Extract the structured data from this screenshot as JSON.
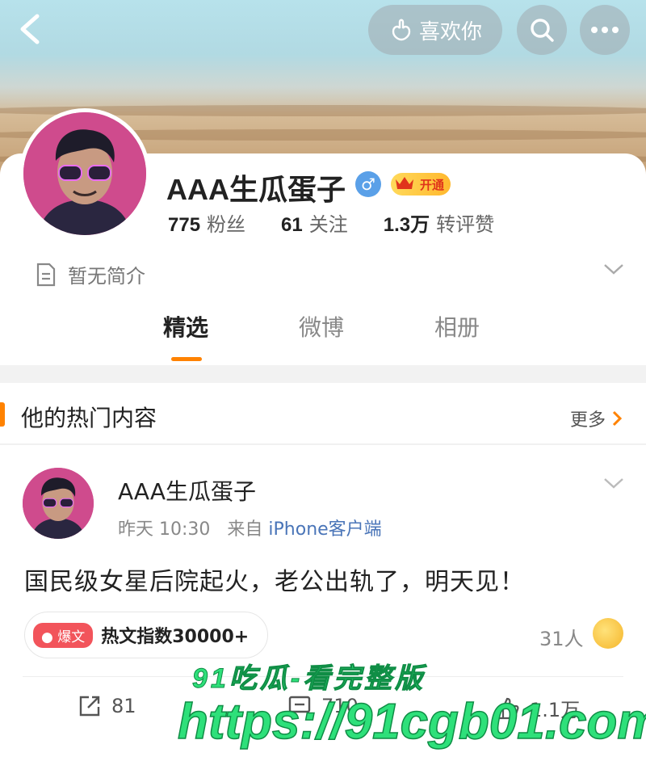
{
  "header": {
    "like_label": "喜欢你"
  },
  "profile": {
    "name": "AAA生瓜蛋子",
    "vip_label": "开通",
    "stats": [
      {
        "num": "775",
        "label": "粉丝"
      },
      {
        "num": "61",
        "label": "关注"
      },
      {
        "num": "1.3万",
        "label": "转评赞"
      }
    ],
    "intro": "暂无简介"
  },
  "tabs": [
    {
      "label": "精选",
      "active": true
    },
    {
      "label": "微博",
      "active": false
    },
    {
      "label": "相册",
      "active": false
    }
  ],
  "hot_section": {
    "title": "他的热门内容",
    "more_label": "更多"
  },
  "post": {
    "author": "AAA生瓜蛋子",
    "time": "昨天 10:30",
    "from_prefix": "来自",
    "source": "iPhone客户端",
    "text": "国民级女星后院起火，老公出轨了，明天见！",
    "heat_badge": "爆文",
    "heat_text": "热文指数30000+",
    "people": "31人",
    "reposts": "81",
    "comments": "710",
    "likes": "1.1万"
  },
  "watermark": {
    "line1": "91吃瓜-看完整版",
    "line2": "https://91cgb01.com"
  },
  "colors": {
    "accent": "#ff8200",
    "link": "#4a75b8"
  }
}
